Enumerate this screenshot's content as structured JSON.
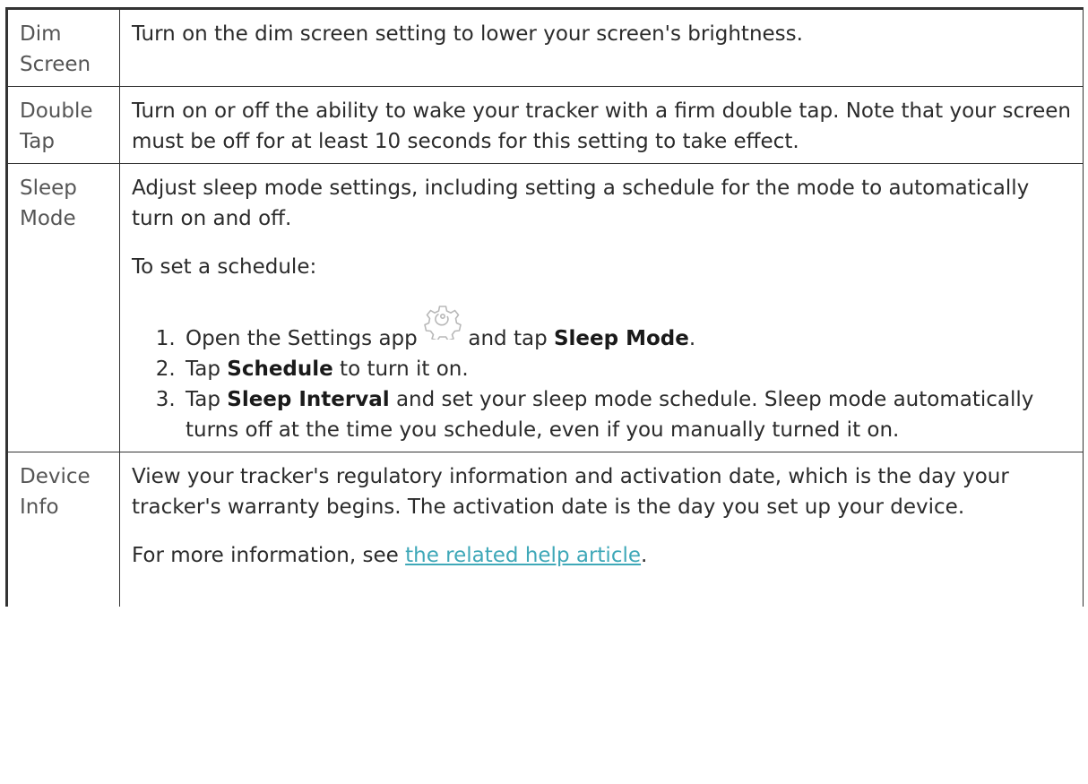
{
  "rows": [
    {
      "label": "Dim Screen",
      "text": "Turn on the dim screen setting to lower your screen's brightness."
    },
    {
      "label": "Double Tap",
      "text": "Turn on or off the ability to wake your tracker with a firm double tap. Note that your screen must be off for at least 10 seconds for this setting to take effect."
    },
    {
      "label": "Sleep Mode",
      "text": "Adjust sleep mode settings, including setting a schedule for the mode to automatically turn on and off.",
      "schedule_intro": "To set a schedule:",
      "steps": [
        {
          "before": "Open the Settings app",
          "icon": "gear-icon",
          "middle": " and tap ",
          "bold": "Sleep Mode",
          "after": "."
        },
        {
          "before": "Tap ",
          "bold": "Schedule",
          "after": " to turn it on."
        },
        {
          "before": "Tap ",
          "bold": "Sleep Interval",
          "after": " and set your sleep mode schedule. Sleep mode automatically turns off at the time you schedule, even if you manually turned it on."
        }
      ]
    },
    {
      "label": "Device Info",
      "text": "View your tracker's regulatory information and activation date, which is the day your tracker's warranty begins. The activation date is the day you set up your device.",
      "more_before": "For more information, see ",
      "more_link": "the related help article",
      "more_after": "."
    }
  ],
  "colors": {
    "text": "#2b2b2b",
    "label": "#555555",
    "link": "#3fa8b8",
    "border": "#333333"
  }
}
